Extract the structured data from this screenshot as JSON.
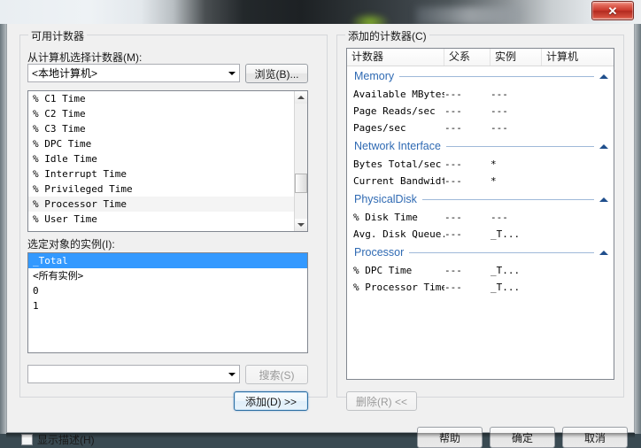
{
  "window": {
    "close_glyph": "✕"
  },
  "available_counters": {
    "group_title": "可用计数器",
    "source_label": "从计算机选择计数器(M):",
    "source_value": "<本地计算机>",
    "browse_button": "浏览(B)...",
    "counters": [
      "% C1 Time",
      "% C2 Time",
      "% C3 Time",
      "% DPC Time",
      "% Idle Time",
      "% Interrupt Time",
      "% Privileged Time",
      "% Processor Time",
      "% User Time"
    ],
    "selected_counter": "% Processor Time",
    "instances_label": "选定对象的实例(I):",
    "instances": [
      "_Total",
      "<所有实例>",
      "0",
      "1"
    ],
    "selected_instance": "_Total",
    "search_value": "",
    "search_button": "搜索(S)",
    "add_button": "添加(D)  >>"
  },
  "added_counters": {
    "group_title": "添加的计数器(C)",
    "columns": [
      "计数器",
      "父系",
      "实例",
      "计算机"
    ],
    "groups": [
      {
        "name": "Memory",
        "rows": [
          {
            "counter": "Available MBytes",
            "parent": "---",
            "instance": "---",
            "computer": ""
          },
          {
            "counter": "Page Reads/sec",
            "parent": "---",
            "instance": "---",
            "computer": ""
          },
          {
            "counter": "Pages/sec",
            "parent": "---",
            "instance": "---",
            "computer": ""
          }
        ]
      },
      {
        "name": "Network Interface",
        "rows": [
          {
            "counter": "Bytes Total/sec",
            "parent": "---",
            "instance": "*",
            "computer": ""
          },
          {
            "counter": "Current Bandwidth",
            "parent": "---",
            "instance": "*",
            "computer": ""
          }
        ]
      },
      {
        "name": "PhysicalDisk",
        "rows": [
          {
            "counter": "% Disk Time",
            "parent": "---",
            "instance": "---",
            "computer": ""
          },
          {
            "counter": "Avg. Disk Queue...",
            "parent": "---",
            "instance": "_T...",
            "computer": ""
          }
        ]
      },
      {
        "name": "Processor",
        "rows": [
          {
            "counter": "% DPC Time",
            "parent": "---",
            "instance": "_T...",
            "computer": ""
          },
          {
            "counter": "% Processor Time",
            "parent": "---",
            "instance": "_T...",
            "computer": ""
          }
        ]
      }
    ],
    "remove_button": "删除(R)  <<"
  },
  "footer": {
    "show_description": "显示描述(H)",
    "help_button": "帮助",
    "ok_button": "确定",
    "cancel_button": "取消"
  },
  "colors": {
    "group_header": "#2f6ab3",
    "selection": "#3399ff",
    "close_red": "#c8362a"
  }
}
